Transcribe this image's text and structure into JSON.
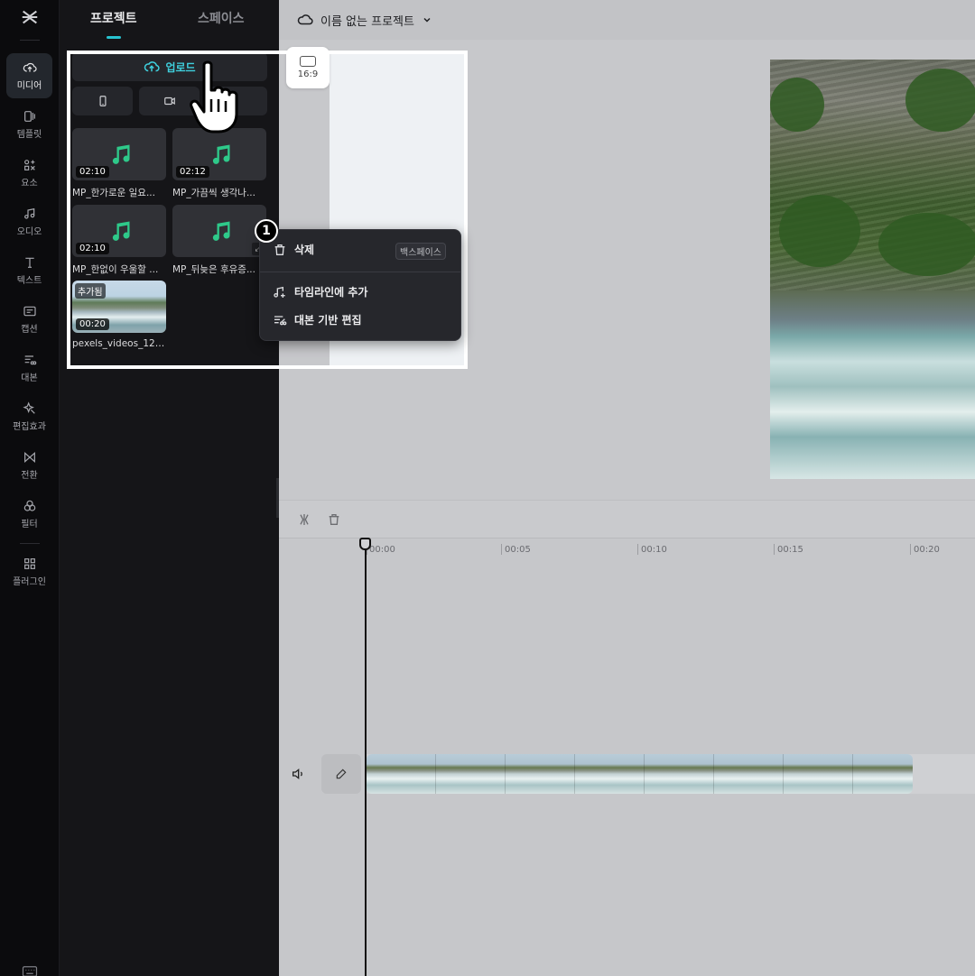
{
  "rail": {
    "items": [
      {
        "id": "media",
        "label": "미디어",
        "icon": "cloud-upload-icon",
        "active": true
      },
      {
        "id": "templates",
        "label": "템플릿",
        "icon": "template-icon"
      },
      {
        "id": "elements",
        "label": "요소",
        "icon": "elements-icon"
      },
      {
        "id": "audio",
        "label": "오디오",
        "icon": "music-note-icon"
      },
      {
        "id": "text",
        "label": "텍스트",
        "icon": "text-icon"
      },
      {
        "id": "captions",
        "label": "캡션",
        "icon": "caption-icon"
      },
      {
        "id": "script",
        "label": "대본",
        "icon": "script-icon"
      },
      {
        "id": "effects",
        "label": "편집효과",
        "icon": "sparkle-icon"
      },
      {
        "id": "transitions",
        "label": "전환",
        "icon": "transition-icon"
      },
      {
        "id": "filters",
        "label": "필터",
        "icon": "filter-icon"
      },
      {
        "id": "plugins",
        "label": "플러그인",
        "icon": "grid-icon"
      }
    ]
  },
  "panel": {
    "tabs": [
      "프로젝트",
      "스페이스"
    ],
    "upload_label": "업로드",
    "cards": [
      {
        "duration": "02:10",
        "name": "MP_한가로운 일요...",
        "type": "audio"
      },
      {
        "duration": "02:12",
        "name": "MP_가끔씩 생각나...",
        "type": "audio"
      },
      {
        "duration": "02:10",
        "name": "MP_한없이 우울할 ...",
        "type": "audio"
      },
      {
        "duration": "",
        "name": "MP_뒤늦은 후유증...",
        "type": "audio"
      },
      {
        "duration": "00:20",
        "name": "pexels_videos_1291...",
        "type": "video",
        "badge": "추가됨"
      }
    ]
  },
  "header": {
    "project_name": "이름 없는 프로젝트"
  },
  "preview": {
    "ratio_label": "16:9"
  },
  "context_menu": {
    "step_number": "1",
    "items": [
      {
        "label": "삭제",
        "icon": "trash-icon",
        "shortcut": "백스페이스"
      },
      {
        "label": "타임라인에 추가",
        "icon": "add-to-timeline-icon"
      },
      {
        "label": "대본 기반 편집",
        "icon": "script-edit-icon"
      }
    ]
  },
  "timeline": {
    "ticks": [
      "00:00",
      "00:05",
      "00:10",
      "00:15",
      "00:20"
    ]
  },
  "colors": {
    "accent": "#27c3d0",
    "audio_note": "#2ec98a"
  }
}
